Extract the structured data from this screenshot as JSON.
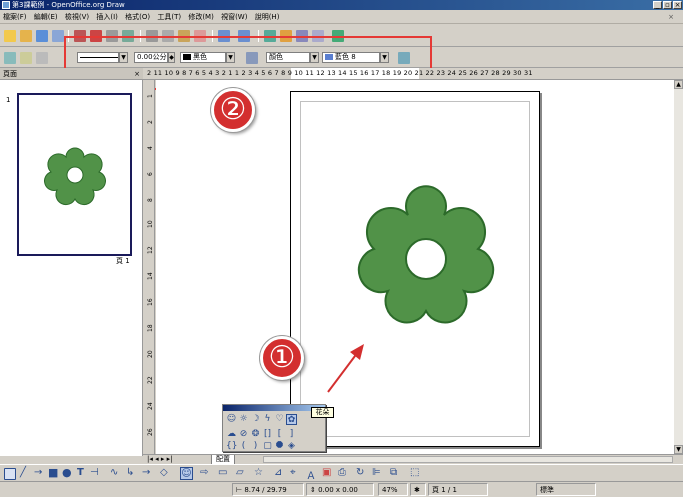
{
  "window": {
    "title": "第3課範例 - OpenOffice.org Draw"
  },
  "menu": {
    "items": [
      "檔案(F)",
      "編輯(E)",
      "檢視(V)",
      "插入(I)",
      "格式(O)",
      "工具(T)",
      "修改(M)",
      "視窗(W)",
      "說明(H)"
    ]
  },
  "line_toolbar": {
    "line_width": "0.00公分",
    "line_color": "黑色",
    "area_style": "顏色",
    "area_color": "藍色 8"
  },
  "callouts": [
    "②",
    "①"
  ],
  "pages_pane": {
    "title": "頁面",
    "page_number": "1",
    "page_label": "頁 1",
    "close": "×"
  },
  "ruler": {
    "horizontal": "2 11 10 9 8 7 6 5 4 3 2 1   1 2 3 4 5 6 7 8 9 10 11 12 13 14 15 16 17 18 19 20 21 22 23 24 25 26 27 28 29 30 31"
  },
  "tabs": {
    "layout": "配置"
  },
  "palette": {
    "tooltip": "花朵"
  },
  "status": {
    "position": "8.74 / 29.79",
    "size": "0.00 x 0.00",
    "zoom": "47%",
    "page": "頁 1 / 1",
    "style": "標準"
  },
  "colors": {
    "shape_fill": "#519248",
    "shape_stroke": "#2c6a2a",
    "accent": "#0a246a",
    "callout": "#d32f2f"
  }
}
